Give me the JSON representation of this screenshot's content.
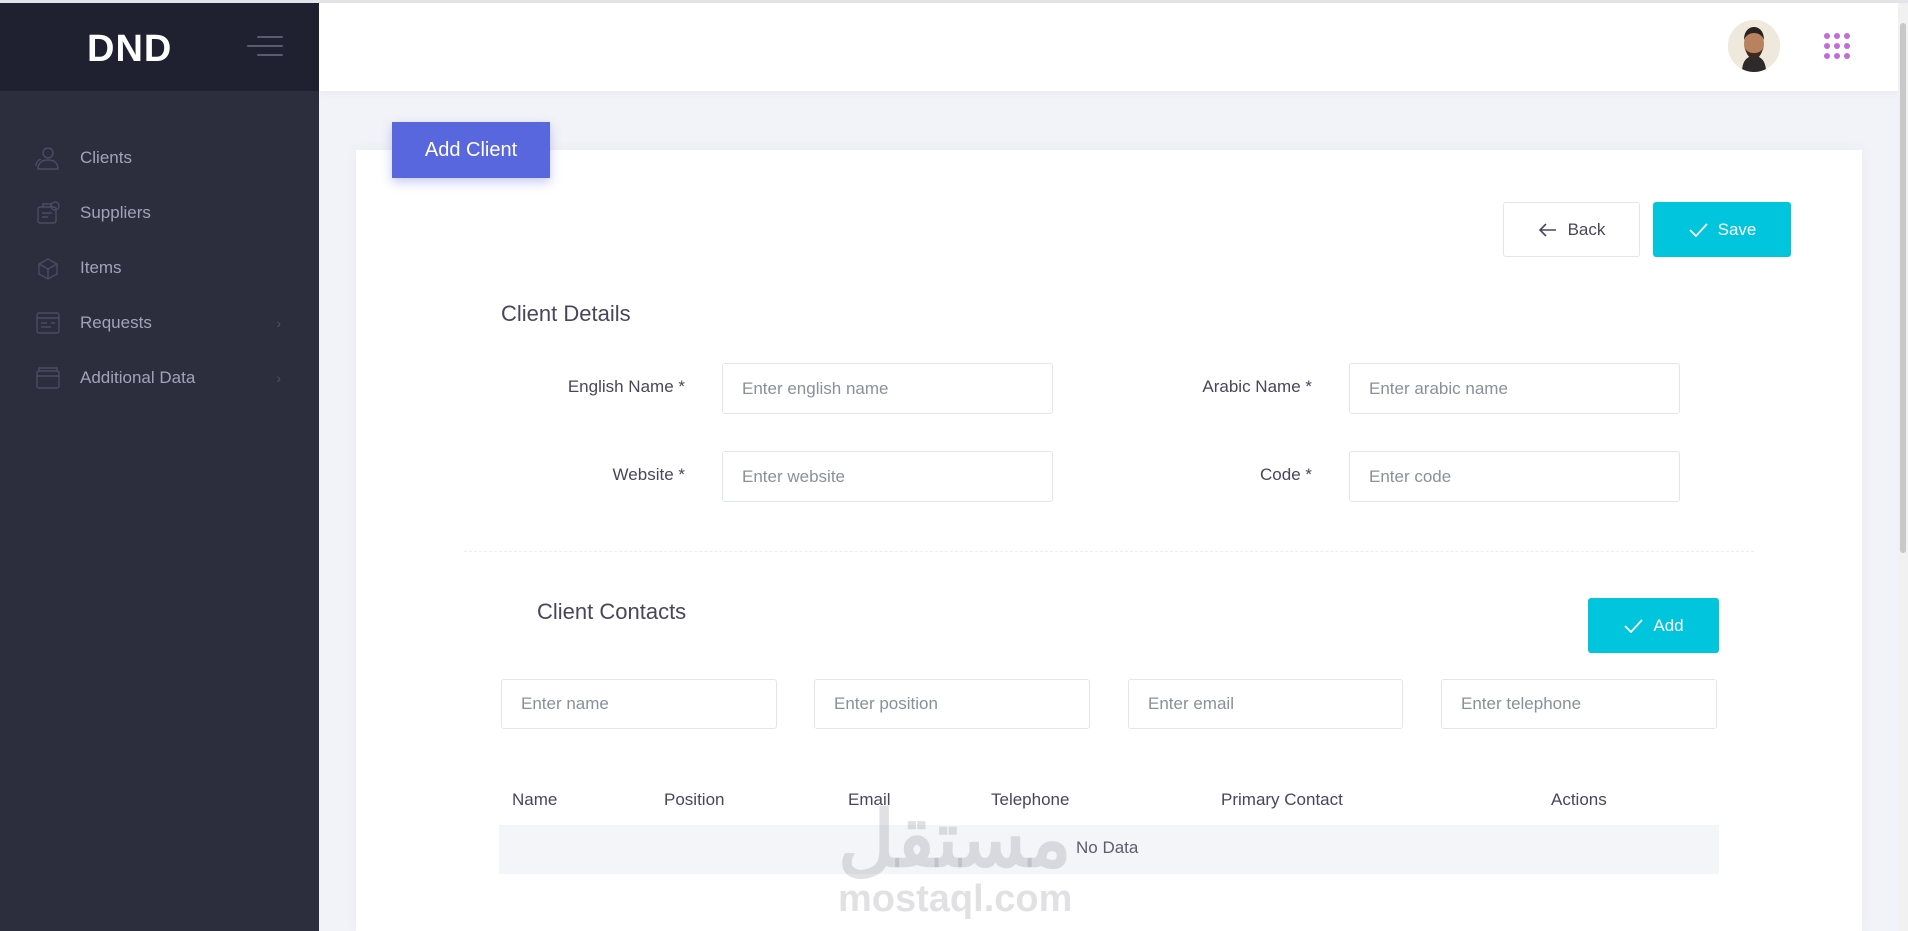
{
  "app": {
    "brand": "DND"
  },
  "sidebar": {
    "items": [
      {
        "label": "Clients",
        "icon": "users-icon",
        "has_submenu": false
      },
      {
        "label": "Suppliers",
        "icon": "supplier-icon",
        "has_submenu": false
      },
      {
        "label": "Items",
        "icon": "box-icon",
        "has_submenu": false
      },
      {
        "label": "Requests",
        "icon": "requests-icon",
        "has_submenu": true
      },
      {
        "label": "Additional Data",
        "icon": "folder-icon",
        "has_submenu": true
      }
    ],
    "chevron": "›"
  },
  "page": {
    "tab_title": "Add Client",
    "back_label": "Back",
    "save_label": "Save"
  },
  "client_details": {
    "title": "Client Details",
    "english_name": {
      "label": "English Name *",
      "placeholder": "Enter english name",
      "value": ""
    },
    "arabic_name": {
      "label": "Arabic Name *",
      "placeholder": "Enter arabic name",
      "value": ""
    },
    "website": {
      "label": "Website *",
      "placeholder": "Enter website",
      "value": ""
    },
    "code": {
      "label": "Code *",
      "placeholder": "Enter code",
      "value": ""
    }
  },
  "client_contacts": {
    "title": "Client Contacts",
    "add_label": "Add",
    "name_placeholder": "Enter name",
    "position_placeholder": "Enter position",
    "email_placeholder": "Enter email",
    "telephone_placeholder": "Enter telephone",
    "table": {
      "columns": [
        "Name",
        "Position",
        "Email",
        "Telephone",
        "Primary Contact",
        "Actions"
      ],
      "rows": [],
      "empty_text": "No Data"
    }
  },
  "watermark": {
    "arabic": "مستقل",
    "latin": "mostaql.com"
  },
  "colors": {
    "sidebar_bg": "#2c2e3e",
    "brand_bg": "#1f2130",
    "primary": "#5867dd",
    "accent": "#00c5dc",
    "page_bg": "#f2f3f8"
  }
}
